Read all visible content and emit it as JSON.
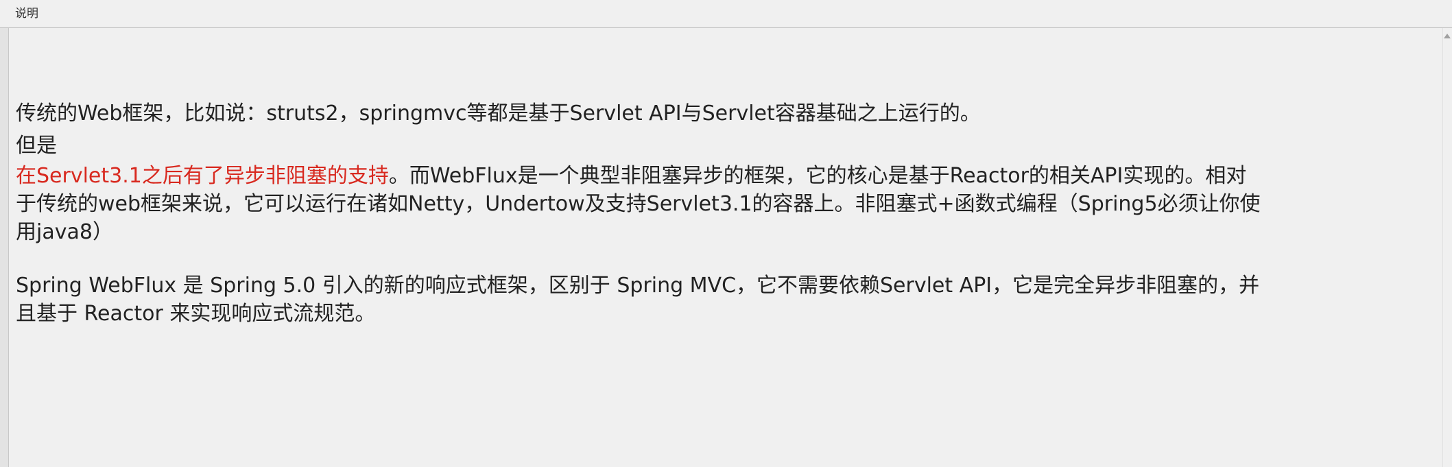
{
  "window": {
    "title": "说明"
  },
  "content": {
    "para1": "传统的Web框架，比如说：struts2，springmvc等都是基于Servlet API与Servlet容器基础之上运行的。",
    "para2": "但是",
    "para3_highlight": "在Servlet3.1之后有了异步非阻塞的支持",
    "para3_line1_rest": "。而WebFlux是一个典型非阻塞异步的框架，它的核心是基于Reactor的相关API实现的。相对",
    "para3_line2": "于传统的web框架来说，它可以运行在诸如Netty，Undertow及支持Servlet3.1的容器上。非阻塞式+函数式编程（Spring5必须让你使",
    "para3_line3": "用java8）",
    "para4_line1": "Spring WebFlux 是 Spring 5.0 引入的新的响应式框架，区别于 Spring MVC，它不需要依赖Servlet API，它是完全异步非阻塞的，并",
    "para4_line2": "且基于 Reactor 来实现响应式流规范。"
  },
  "colors": {
    "highlight": "#d8291f",
    "text": "#222222",
    "background": "#f0f0f0"
  }
}
